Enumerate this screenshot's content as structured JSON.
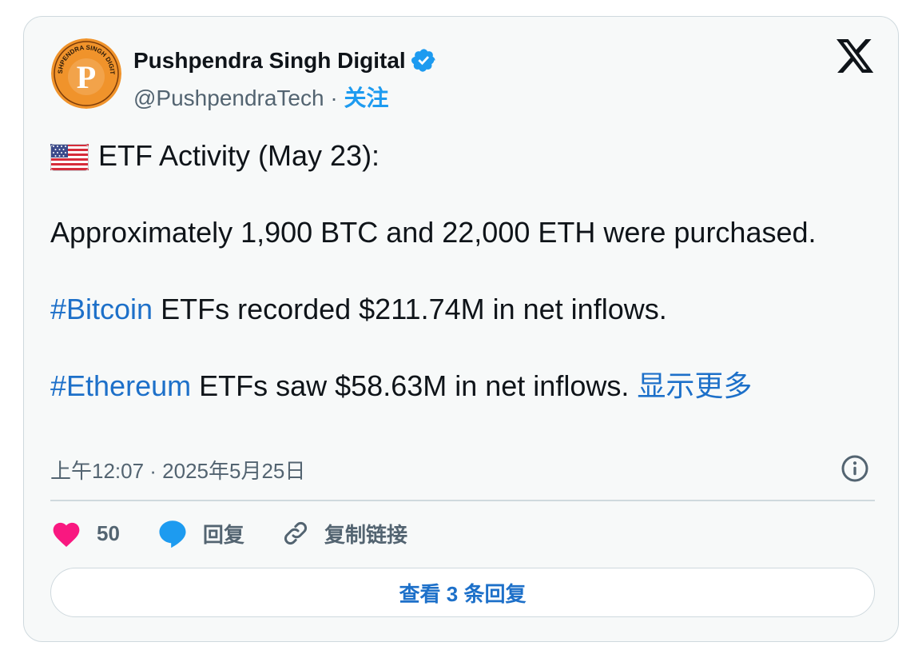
{
  "author": {
    "name": "Pushpendra Singh Digital",
    "handle": "@PushpendraTech",
    "separator": " · ",
    "follow_label": "关注",
    "avatar": {
      "letter": "P",
      "ring_text": "PUSHPENDRA SINGH DIGITAL",
      "color": "#f0932b"
    },
    "verified_icon": "verified-badge-icon"
  },
  "tweet": {
    "line1": "ETF Activity (May 23):",
    "line2": "Approximately 1,900 BTC and 22,000 ETH were purchased.",
    "hashtag1": "#Bitcoin",
    "line3_rest": " ETFs recorded $211.74M in net inflows.",
    "hashtag2": "#Ethereum",
    "line4_rest": " ETFs saw $58.63M in net inflows. ",
    "show_more": "显示更多",
    "flag_icon": "us-flag-icon"
  },
  "timestamp": "上午12:07 · 2025年5月25日",
  "actions": {
    "like_count": "50",
    "reply_label": "回复",
    "copy_link_label": "复制链接"
  },
  "view_replies_label": "查看 3 条回复",
  "colors": {
    "accent": "#1d9bf0",
    "link": "#1d70c9",
    "like": "#f91880",
    "card_bg": "#f7f9f9",
    "border": "#cfd9de"
  }
}
